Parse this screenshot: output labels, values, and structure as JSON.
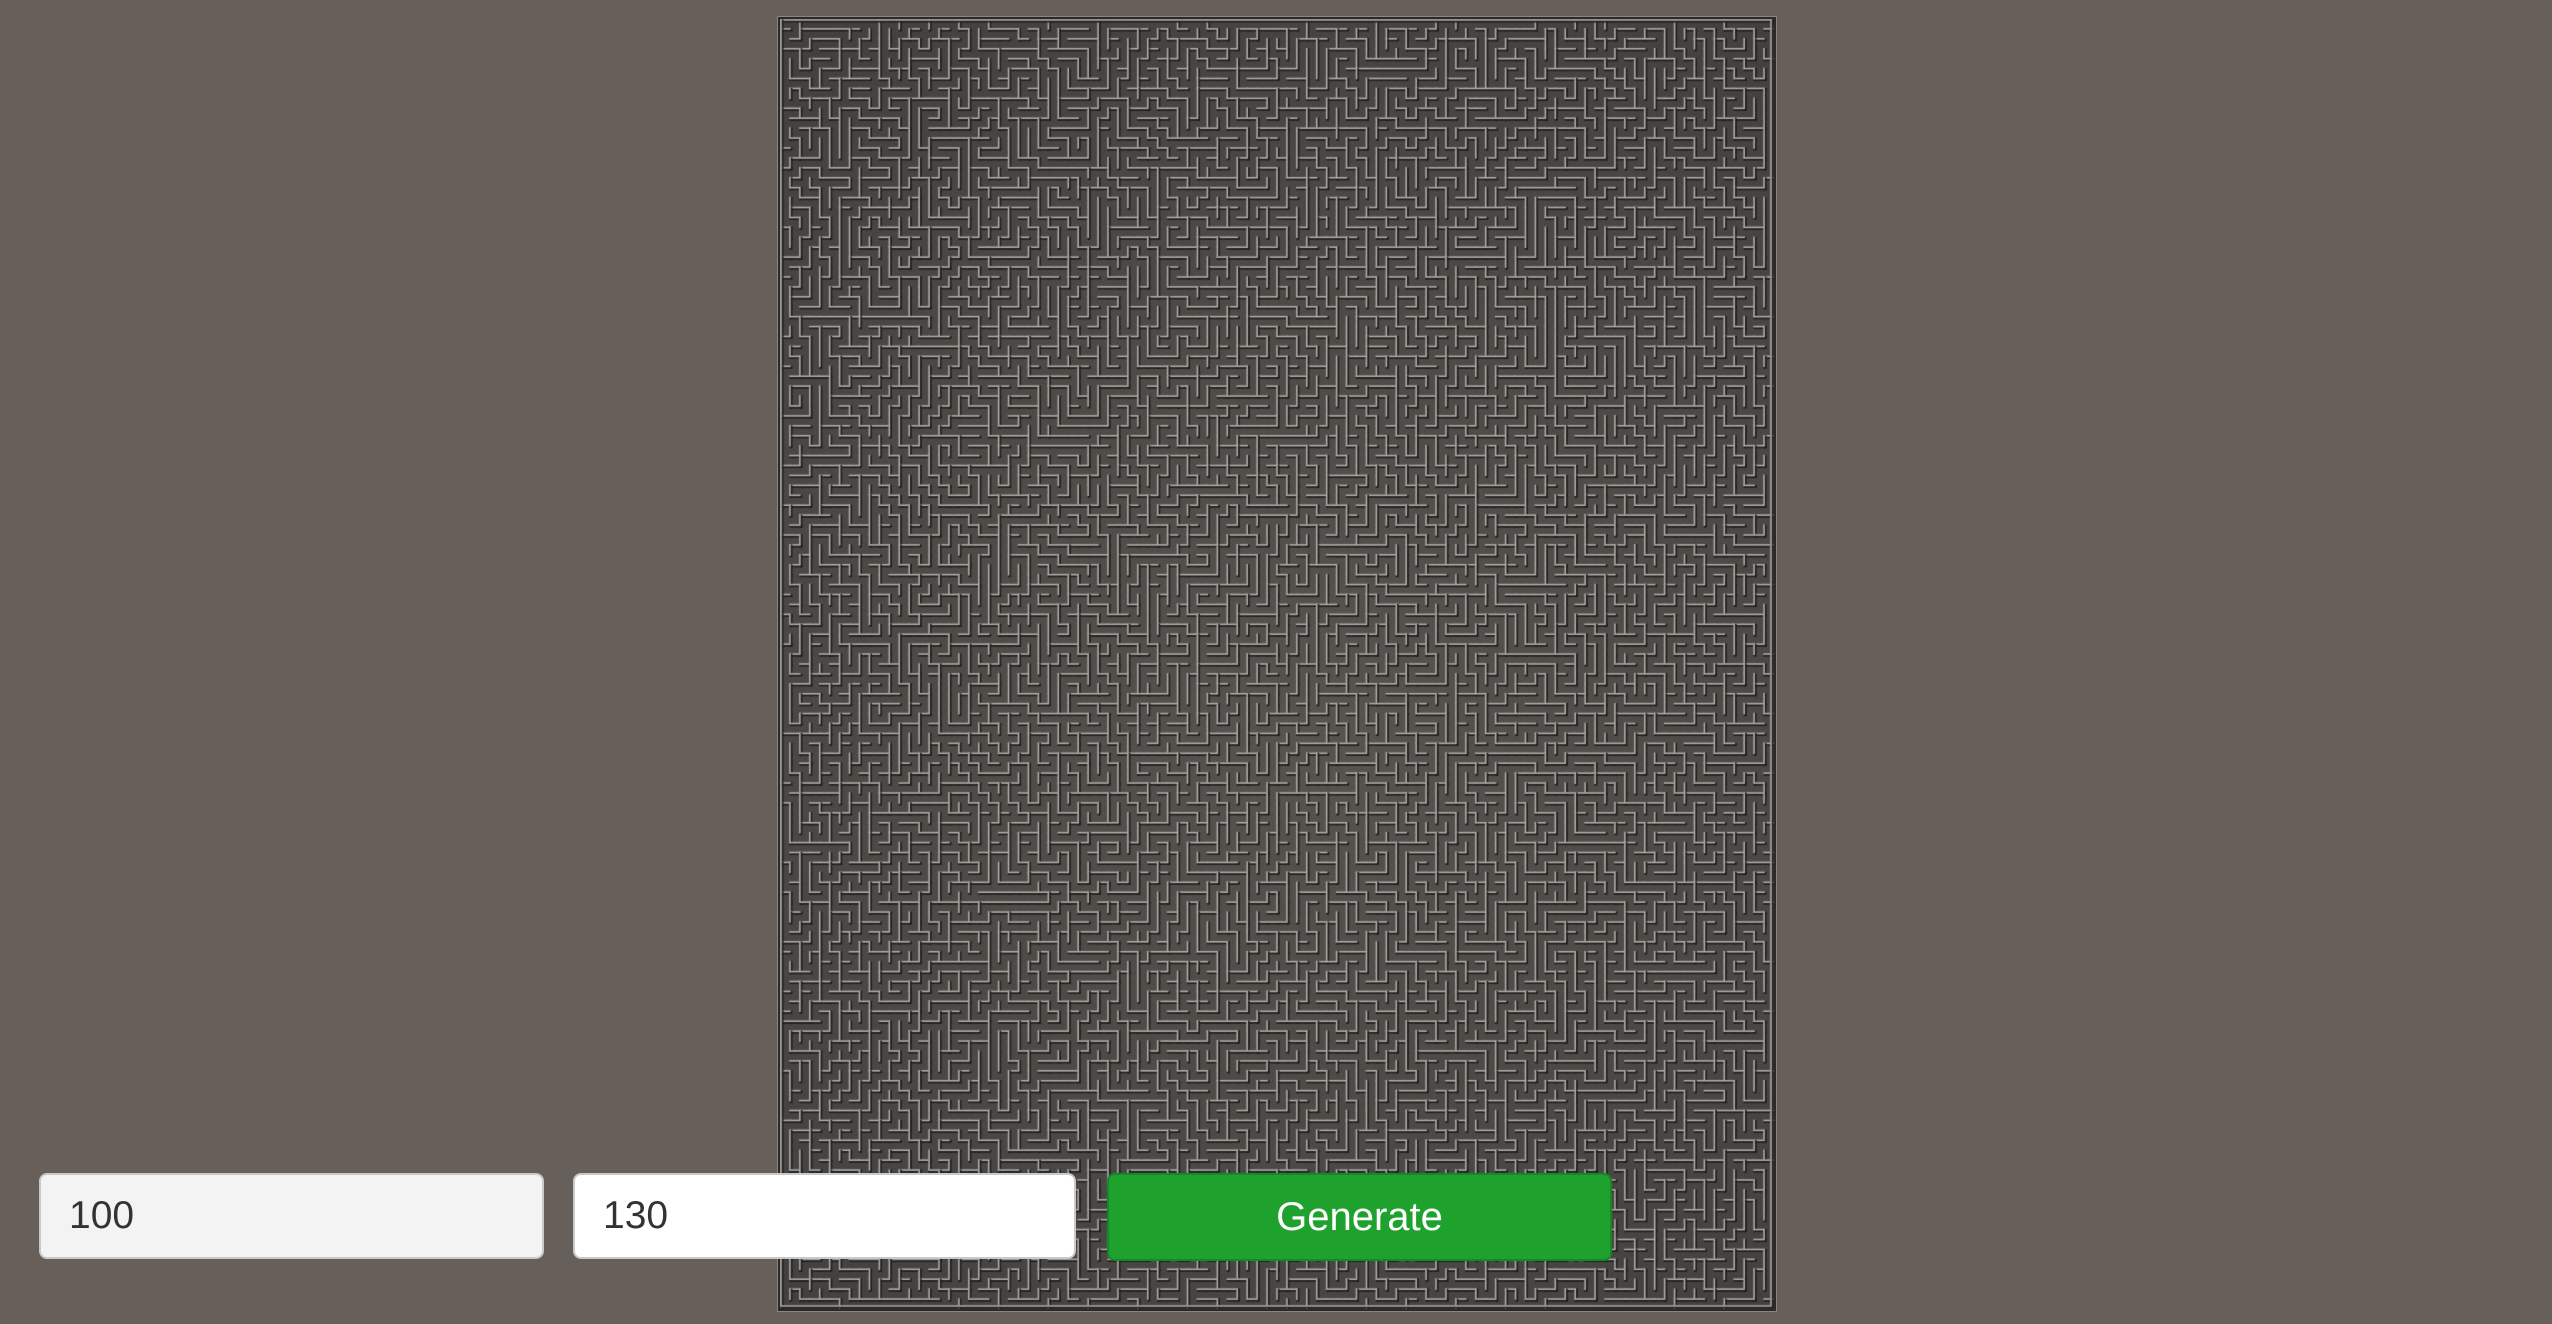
{
  "controls": {
    "width_value": "100",
    "height_value": "130",
    "generate_label": "Generate",
    "generate_color": "#1fa22d"
  },
  "maze": {
    "columns": 100,
    "rows": 130,
    "floor_color": "#3f3d3a",
    "wall_light": "#b5b1ac",
    "wall_dark": "#1e1d1c"
  },
  "background_color": "#675f59"
}
